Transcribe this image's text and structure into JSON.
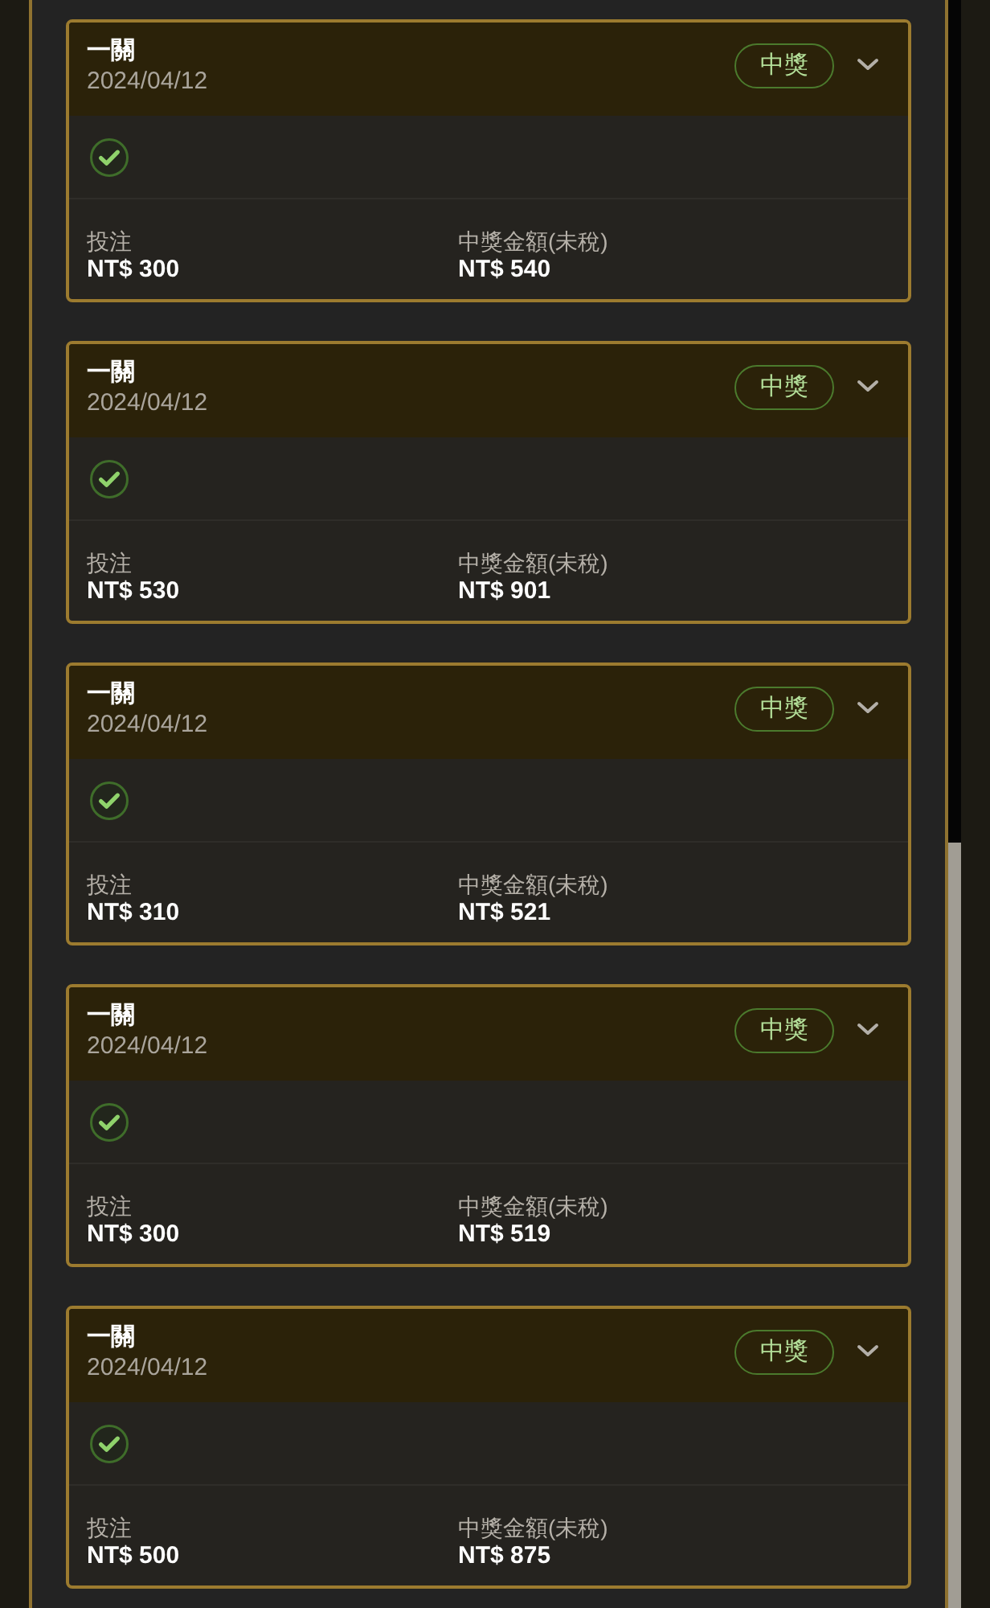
{
  "bets": [
    {
      "title": "一關",
      "date": "2024/04/12",
      "status": {
        "label": "中獎",
        "kind": "won"
      },
      "expanded": false,
      "leg": {
        "kind": "won"
      },
      "stake": {
        "label": "投注",
        "value": "NT$ 300"
      },
      "payout": {
        "label": "中獎金額(未稅)",
        "value": "NT$ 540"
      }
    },
    {
      "title": "一關",
      "date": "2024/04/12",
      "status": {
        "label": "中獎",
        "kind": "won"
      },
      "expanded": false,
      "leg": {
        "kind": "won"
      },
      "stake": {
        "label": "投注",
        "value": "NT$ 530"
      },
      "payout": {
        "label": "中獎金額(未稅)",
        "value": "NT$ 901"
      }
    },
    {
      "title": "一關",
      "date": "2024/04/12",
      "status": {
        "label": "中獎",
        "kind": "won"
      },
      "expanded": false,
      "leg": {
        "kind": "won"
      },
      "stake": {
        "label": "投注",
        "value": "NT$ 310"
      },
      "payout": {
        "label": "中獎金額(未稅)",
        "value": "NT$ 521"
      }
    },
    {
      "title": "一關",
      "date": "2024/04/12",
      "status": {
        "label": "中獎",
        "kind": "won"
      },
      "expanded": false,
      "leg": {
        "kind": "won"
      },
      "stake": {
        "label": "投注",
        "value": "NT$ 300"
      },
      "payout": {
        "label": "中獎金額(未稅)",
        "value": "NT$ 519"
      }
    },
    {
      "title": "一關",
      "date": "2024/04/12",
      "status": {
        "label": "中獎",
        "kind": "won"
      },
      "expanded": false,
      "leg": {
        "kind": "won"
      },
      "stake": {
        "label": "投注",
        "value": "NT$ 500"
      },
      "payout": {
        "label": "中獎金額(未稅)",
        "value": "NT$ 875"
      }
    }
  ]
}
